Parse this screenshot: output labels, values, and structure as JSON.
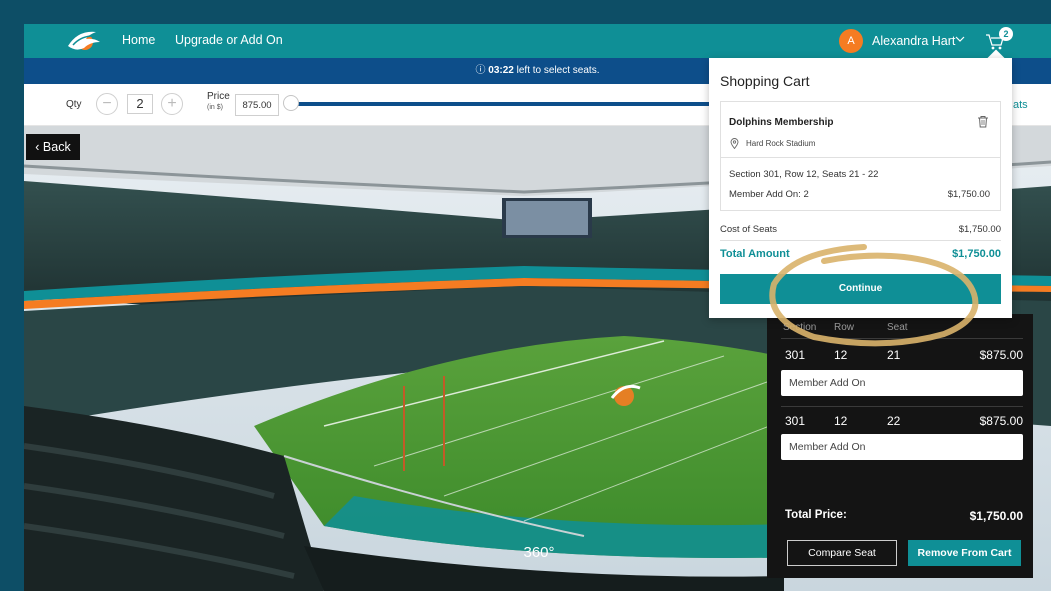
{
  "nav": {
    "home": "Home",
    "upgrade": "Upgrade or Add On",
    "user_initial": "A",
    "user_name": "Alexandra Hart",
    "cart_count": "2"
  },
  "timer": {
    "time": "03:22",
    "suffix": " left to select seats."
  },
  "filters": {
    "qty_label": "Qty",
    "qty_value": "2",
    "price_label": "Price",
    "price_unit": "(in $)",
    "price_value": "875.00",
    "right_text": "ats"
  },
  "view": {
    "back_label": "Back",
    "view360_label": "360°"
  },
  "seat_panel": {
    "headers": {
      "section": "Section",
      "row": "Row",
      "seat": "Seat"
    },
    "seats": [
      {
        "section": "301",
        "row": "12",
        "seat": "21",
        "price": "$875.00",
        "option": "Member Add On"
      },
      {
        "section": "301",
        "row": "12",
        "seat": "22",
        "price": "$875.00",
        "option": "Member Add On"
      }
    ],
    "total_label": "Total Price:",
    "total_value": "$1,750.00",
    "compare_label": "Compare Seat",
    "remove_label": "Remove From Cart"
  },
  "cart": {
    "title": "Shopping Cart",
    "item": {
      "name": "Dolphins Membership",
      "venue": "Hard Rock Stadium",
      "seats": "Section 301, Row 12, Seats 21 - 22",
      "addon": "Member Add On: 2",
      "addon_price": "$1,750.00"
    },
    "cost_label": "Cost of Seats",
    "cost_value": "$1,750.00",
    "total_label": "Total Amount",
    "total_value": "$1,750.00",
    "continue_label": "Continue"
  },
  "colors": {
    "teal": "#0f8f96",
    "navy": "#0d4e8a",
    "orange": "#f57c22",
    "highlight": "#d9b36a"
  }
}
